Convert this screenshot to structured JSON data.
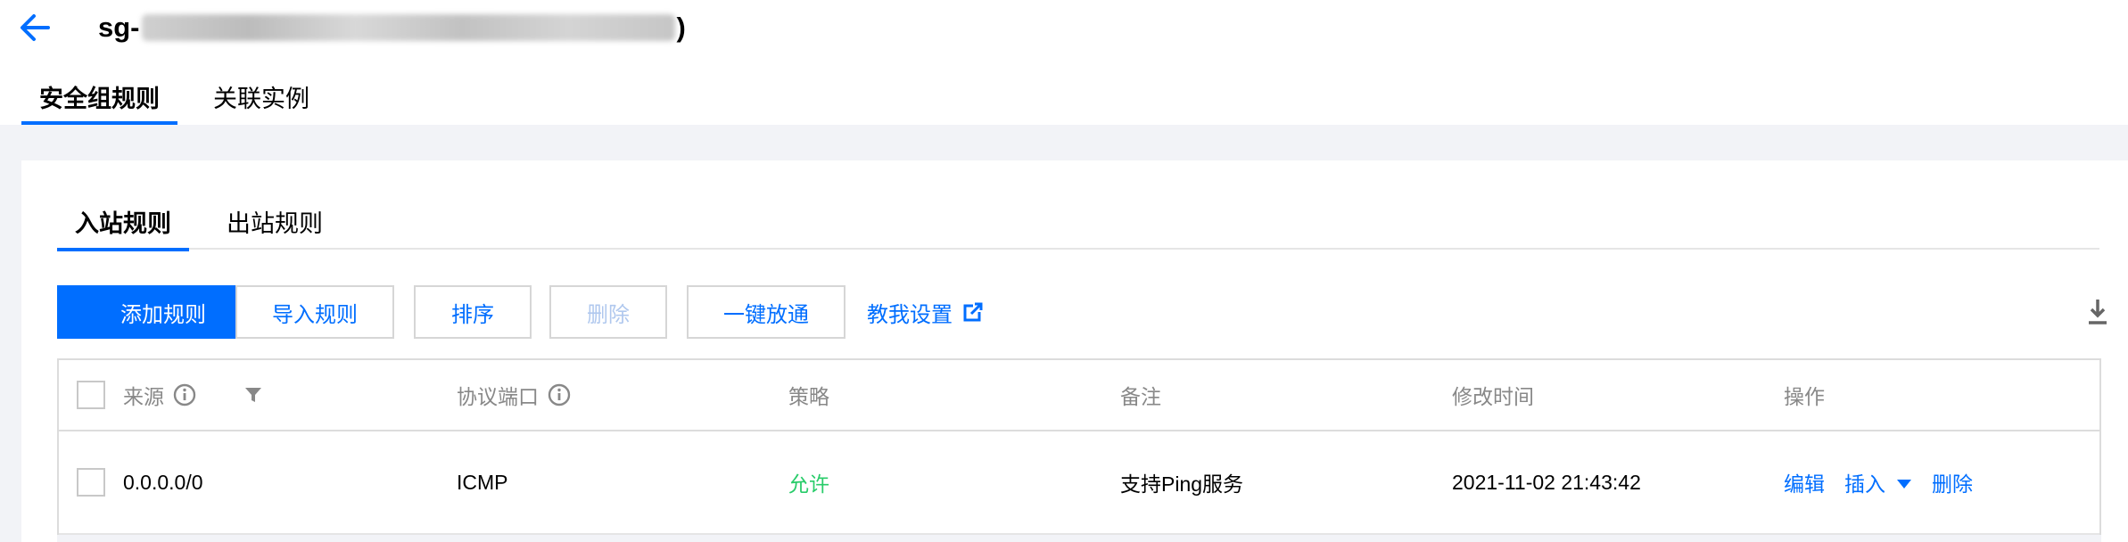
{
  "header": {
    "title_prefix": "sg-",
    "title_suffix": ")",
    "tabs": [
      {
        "label": "安全组规则",
        "active": true
      },
      {
        "label": "关联实例",
        "active": false
      }
    ]
  },
  "rules": {
    "tabs": [
      {
        "label": "入站规则",
        "active": true
      },
      {
        "label": "出站规则",
        "active": false
      }
    ],
    "toolbar": {
      "add": "添加规则",
      "import": "导入规则",
      "sort": "排序",
      "delete": "删除",
      "open_all": "一键放通",
      "help": "教我设置"
    },
    "table": {
      "headers": {
        "source": "来源",
        "protocol_port": "协议端口",
        "policy": "策略",
        "remark": "备注",
        "modified": "修改时间",
        "actions": "操作"
      },
      "rows": [
        {
          "source": "0.0.0.0/0",
          "protocol_port": "ICMP",
          "policy": "允许",
          "remark": "支持Ping服务",
          "modified": "2021-11-02 21:43:42",
          "actions": {
            "edit": "编辑",
            "insert": "插入",
            "delete": "删除"
          }
        }
      ]
    }
  },
  "colors": {
    "accent": "#006eff",
    "allow": "#29cc6a",
    "page_bg": "#f2f3f7"
  }
}
